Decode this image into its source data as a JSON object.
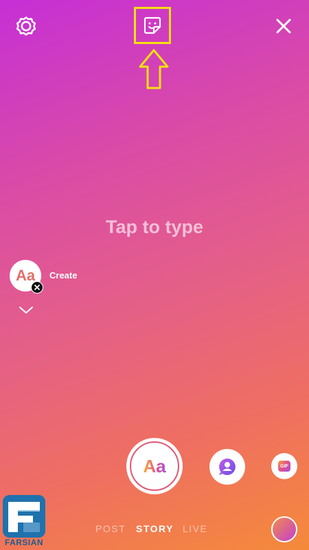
{
  "canvas": {
    "background_start": "#c62fd6",
    "background_end": "#f58a3a"
  },
  "topbar": {
    "settings_icon": "gear-icon",
    "sticker_icon": "sticker-icon",
    "close_icon": "close-icon",
    "highlight_color": "#f4e10f"
  },
  "center": {
    "prompt": "Tap to type"
  },
  "create": {
    "avatar_text": "Aa",
    "label": "Create"
  },
  "bottom": {
    "shutter_text": "Aa",
    "mention_icon": "mention-icon",
    "gif_label": "GIF",
    "modes": [
      "POST",
      "STORY",
      "LIVE"
    ],
    "active_mode": "STORY"
  },
  "watermark": {
    "brand": "FARSIAN"
  }
}
